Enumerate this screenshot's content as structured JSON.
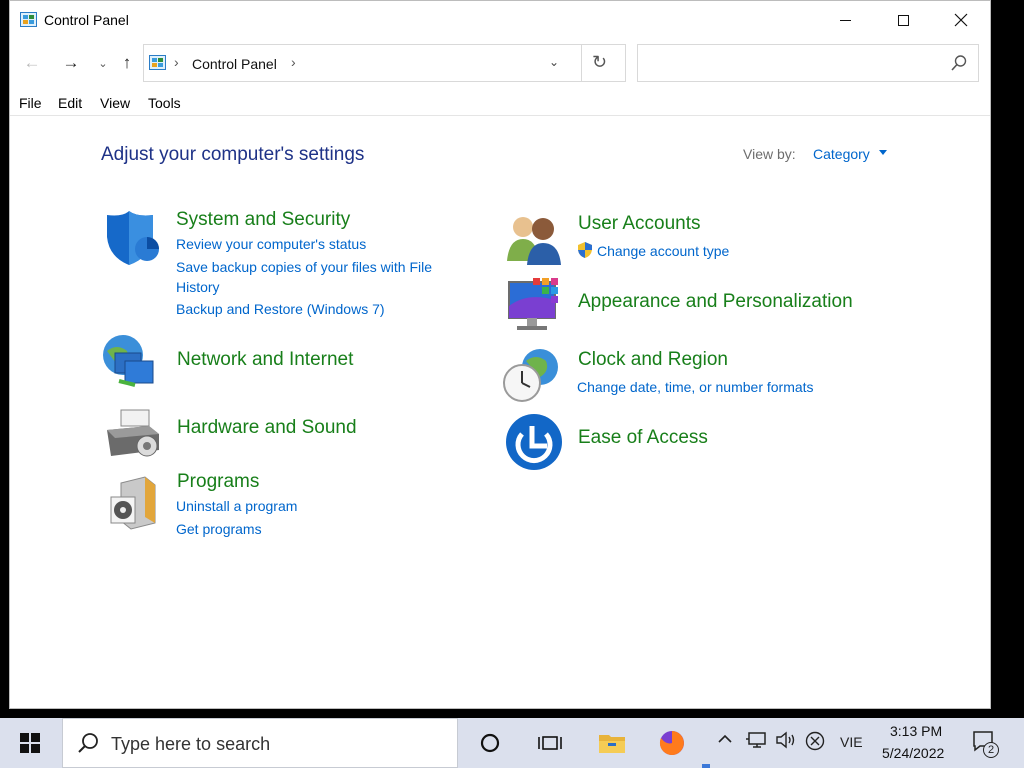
{
  "window": {
    "title": "Control Panel",
    "buttons": {
      "minimize": "minimize",
      "maximize": "maximize",
      "close": "✕"
    }
  },
  "nav": {
    "back_glyph": "←",
    "forward_glyph": "→",
    "recent_glyph": "⌄",
    "up_glyph": "↑",
    "breadcrumb": "Control Panel",
    "crumb_chevron": "›",
    "dropdown_glyph": "⌄",
    "refresh_glyph": "↻",
    "search_placeholder": ""
  },
  "menu": [
    "File",
    "Edit",
    "View",
    "Tools"
  ],
  "content": {
    "heading": "Adjust your computer's settings",
    "view_by_label": "View by:",
    "view_by_value": "Category",
    "left": [
      {
        "title": "System and Security",
        "icon": "shield-icon",
        "links": [
          "Review your computer's status",
          "Save backup copies of your files with File History",
          "Backup and Restore (Windows 7)"
        ]
      },
      {
        "title": "Network and Internet",
        "icon": "network-icon",
        "links": []
      },
      {
        "title": "Hardware and Sound",
        "icon": "printer-icon",
        "links": []
      },
      {
        "title": "Programs",
        "icon": "programs-icon",
        "links": [
          "Uninstall a program",
          "Get programs"
        ]
      }
    ],
    "right": [
      {
        "title": "User Accounts",
        "icon": "users-icon",
        "links": [
          "Change account type"
        ]
      },
      {
        "title": "Appearance and Personalization",
        "icon": "monitor-icon",
        "links": []
      },
      {
        "title": "Clock and Region",
        "icon": "clock-icon",
        "links": [
          "Change date, time, or number formats"
        ]
      },
      {
        "title": "Ease of Access",
        "icon": "ease-of-access-icon",
        "links": []
      }
    ]
  },
  "taskbar": {
    "search_text": "Type here to search",
    "language": "VIE",
    "time": "3:13 PM",
    "date": "5/24/2022",
    "notification_count": "2"
  },
  "colors": {
    "heading_blue": "#1e3287",
    "category_green": "#187f1a",
    "link_blue": "#0066cc",
    "taskbar_bg": "#dbe0ed"
  }
}
